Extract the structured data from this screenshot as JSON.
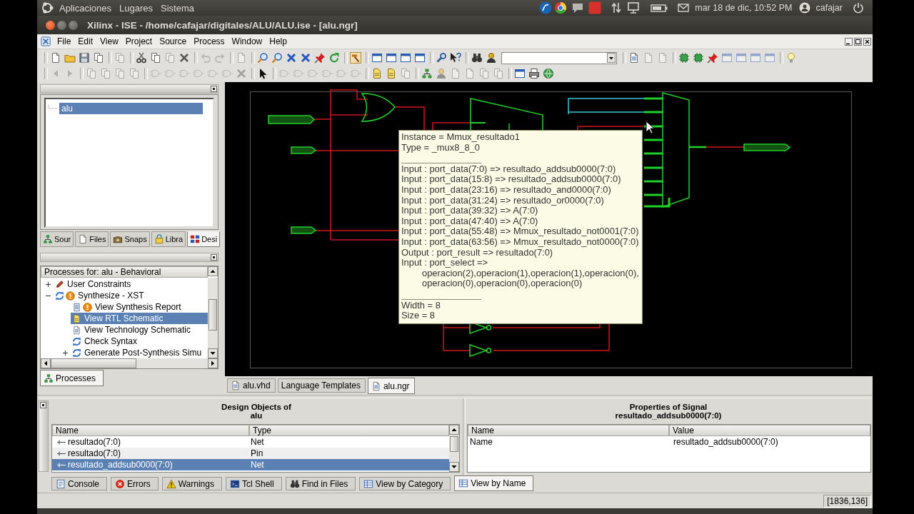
{
  "top_panel": {
    "menus": [
      "Aplicaciones",
      "Lugares",
      "Sistema"
    ],
    "clock": "mar 18 de dic, 10:52 PM",
    "user": "cafajar"
  },
  "window": {
    "title": "Xilinx - ISE - /home/cafajar/digitales/ALU/ALU.ise - [alu.ngr]"
  },
  "menu_bar": [
    "File",
    "Edit",
    "View",
    "Project",
    "Source",
    "Process",
    "Window",
    "Help"
  ],
  "sources_panel": {
    "tree": [
      {
        "label": "alu",
        "selected": true
      }
    ],
    "tabs": [
      {
        "label": "Sour",
        "kind": "sources",
        "selected": false
      },
      {
        "label": "Files",
        "kind": "files",
        "selected": false
      },
      {
        "label": "Snaps",
        "kind": "snapshots",
        "selected": false
      },
      {
        "label": "Libra",
        "kind": "libraries",
        "selected": false
      },
      {
        "label": "Desi",
        "kind": "design",
        "selected": true
      }
    ]
  },
  "processes_panel": {
    "header": "Processes for: alu - Behavioral",
    "items": [
      {
        "label": "User Constraints",
        "kind": "constraints",
        "expanded": false,
        "warning": false,
        "selected": false
      },
      {
        "label": "Synthesize - XST",
        "kind": "process",
        "expanded": true,
        "warning": true,
        "selected": false,
        "children": [
          {
            "label": "View Synthesis Report",
            "kind": "report",
            "warning": true,
            "selected": false
          },
          {
            "label": "View RTL Schematic",
            "kind": "schematic",
            "warning": false,
            "selected": true
          },
          {
            "label": "View Technology Schematic",
            "kind": "technology",
            "warning": false,
            "selected": false
          },
          {
            "label": "Check Syntax",
            "kind": "process",
            "warning": false,
            "selected": false
          },
          {
            "label": "Generate Post-Synthesis Simu",
            "kind": "process",
            "expanded": false,
            "warning": false,
            "selected": false
          }
        ]
      }
    ],
    "tabs": [
      {
        "label": "Processes",
        "selected": true
      }
    ]
  },
  "schematic": {
    "tooltip": {
      "sections": [
        {
          "lines": [
            {
              "text": "Instance = Mmux_resultado1",
              "kind": "plain"
            },
            {
              "text": "Type = _mux8_8_0",
              "kind": "plain"
            }
          ]
        },
        {
          "lines": [
            {
              "text": "Input : port_data(7:0) => resultado_addsub0000(7:0)",
              "kind": "plain"
            },
            {
              "text": "Input : port_data(15:8) => resultado_addsub0000(7:0)",
              "kind": "plain"
            },
            {
              "text": "Input : port_data(23:16) => resultado_and0000(7:0)",
              "kind": "plain"
            },
            {
              "text": "Input : port_data(31:24) => resultado_or0000(7:0)",
              "kind": "plain"
            },
            {
              "text": "Input : port_data(39:32) => A(7:0)",
              "kind": "plain"
            },
            {
              "text": "Input : port_data(47:40) => A(7:0)",
              "kind": "plain"
            },
            {
              "text": "Input : port_data(55:48) => Mmux_resultado_not0001(7:0)",
              "kind": "plain"
            },
            {
              "text": "Input : port_data(63:56) => Mmux_resultado_not0000(7:0)",
              "kind": "plain"
            },
            {
              "text": "Output : port_result => resultado(7:0)",
              "kind": "plain"
            },
            {
              "text": "Input : port_select =>",
              "kind": "plain"
            },
            {
              "text": "operacion(2),operacion(1),operacion(1),operacion(0),",
              "kind": "indented"
            },
            {
              "text": "operacion(0),operacion(0),operacion(0)",
              "kind": "indented"
            }
          ]
        },
        {
          "lines": [
            {
              "text": "Width = 8",
              "kind": "plain"
            },
            {
              "text": "Size = 8",
              "kind": "plain"
            }
          ]
        }
      ]
    }
  },
  "editor_tabs": [
    {
      "label": "alu.vhd",
      "kind": "source",
      "selected": false
    },
    {
      "label": "Language Templates",
      "kind": "plain",
      "selected": false
    },
    {
      "label": "alu.ngr",
      "kind": "schematic",
      "selected": true
    }
  ],
  "design_objects": {
    "title": "Design Objects of",
    "subtitle": "alu",
    "columns": [
      "Name",
      "Type"
    ],
    "rows": [
      {
        "name": "resultado(7:0)",
        "type": "Net",
        "expanded": false,
        "selected": false
      },
      {
        "name": "resultado(7:0)",
        "type": "Pin",
        "expanded": false,
        "selected": false
      },
      {
        "name": "resultado_addsub0000(7:0)",
        "type": "Net",
        "expanded": false,
        "selected": true
      }
    ]
  },
  "properties": {
    "title": "Properties of Signal",
    "subtitle": "resultado_addsub0000(7:0)",
    "columns": [
      "Name",
      "Value"
    ],
    "rows": [
      {
        "name": "Name",
        "value": "resultado_addsub0000(7:0)"
      }
    ]
  },
  "console_tabs": [
    {
      "label": "Console",
      "kind": "console",
      "selected": false
    },
    {
      "label": "Errors",
      "kind": "errors",
      "selected": false
    },
    {
      "label": "Warnings",
      "kind": "warnings",
      "selected": false
    },
    {
      "label": "Tcl Shell",
      "kind": "shell",
      "selected": false
    },
    {
      "label": "Find in Files",
      "kind": "find",
      "selected": false
    },
    {
      "label": "View by Category",
      "kind": "category",
      "selected": false
    },
    {
      "label": "View by Name",
      "kind": "name",
      "selected": true
    }
  ],
  "status_bar": {
    "coordinates": "[1836,136]"
  }
}
